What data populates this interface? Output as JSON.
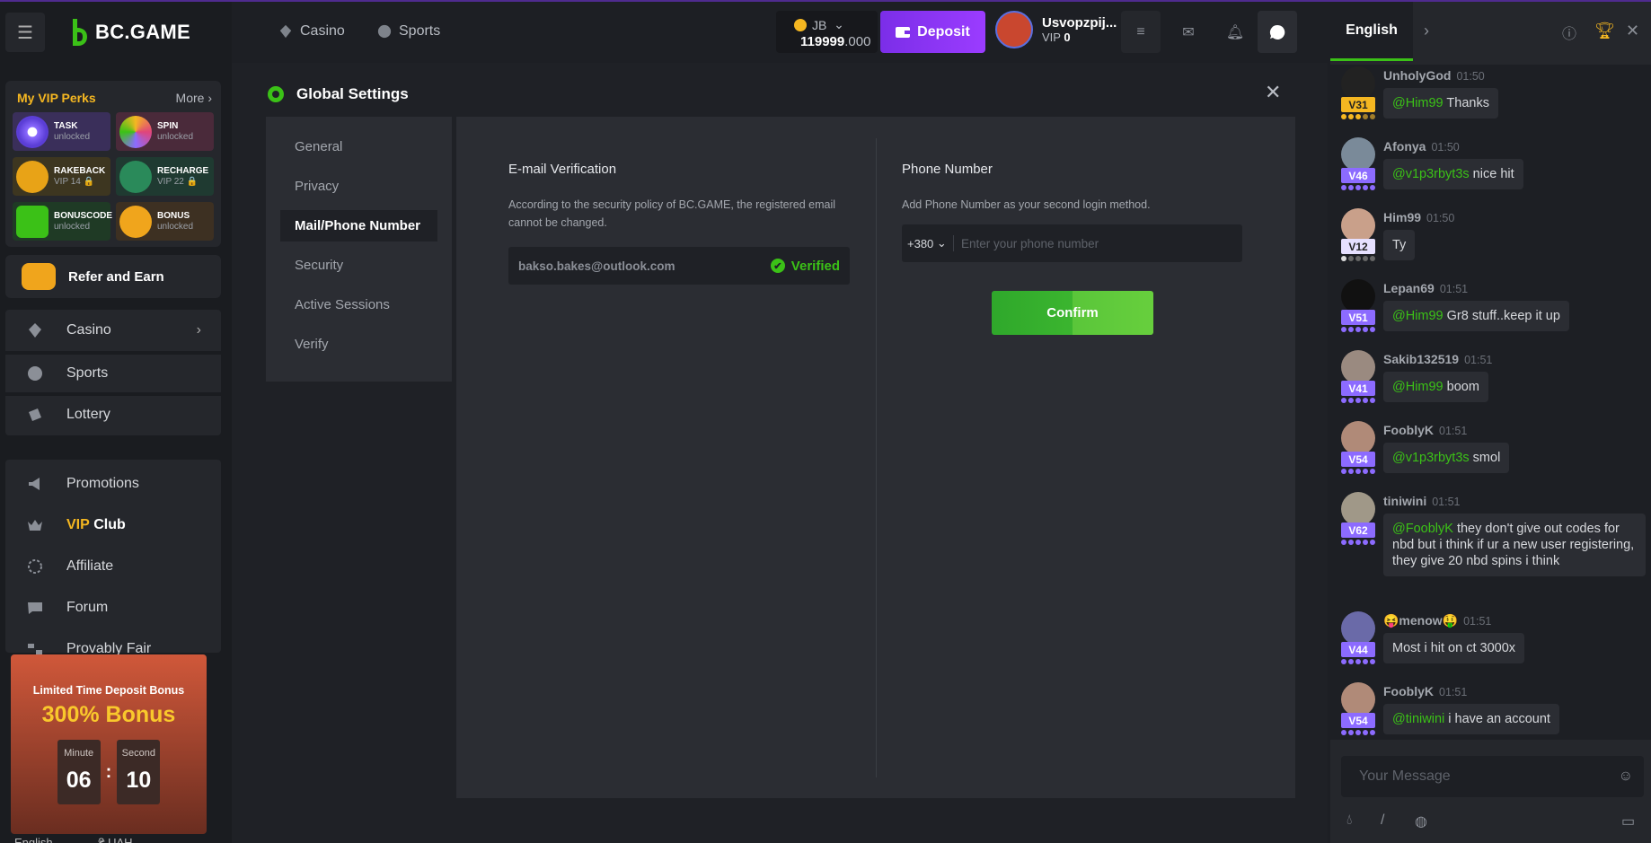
{
  "brand": {
    "name": "BC.GAME",
    "accent": "#3bc117",
    "purple": "#9b3cff",
    "gold": "#f5b721"
  },
  "topbar": {
    "nav": [
      {
        "label": "Casino",
        "icon": "casino-icon"
      },
      {
        "label": "Sports",
        "icon": "sports-icon"
      }
    ],
    "balance": {
      "currency": "JB",
      "amount_main": "119999",
      "amount_decimal": ".000"
    },
    "deposit_label": "Deposit",
    "user": {
      "name": "Usvopzpij...",
      "vip_label": "VIP",
      "vip_value": "0"
    }
  },
  "sidebar": {
    "vip_perks": {
      "title": "My VIP Perks",
      "more": "More",
      "items": [
        {
          "name": "TASK",
          "status": "unlocked",
          "color": "#3a2f5a"
        },
        {
          "name": "SPIN",
          "status": "unlocked",
          "color": "#4a2a3a"
        },
        {
          "name": "RAKEBACK",
          "status": "VIP 14",
          "color": "#3d3620"
        },
        {
          "name": "RECHARGE",
          "status": "VIP 22",
          "color": "#1f3a31"
        },
        {
          "name": "BONUSCODE",
          "status": "unlocked",
          "color": "#1f3a25"
        },
        {
          "name": "BONUS",
          "status": "unlocked",
          "color": "#3d3022"
        }
      ]
    },
    "refer": "Refer and Earn",
    "nav_main": [
      "Casino",
      "Sports",
      "Lottery"
    ],
    "nav_more": {
      "promotions": "Promotions",
      "vip_a": "VIP",
      "vip_b": "Club",
      "affiliate": "Affiliate",
      "forum": "Forum",
      "provably": "Provably Fair"
    },
    "promo": {
      "line1": "Limited Time Deposit Bonus",
      "line2": "300% Bonus",
      "minute_label": "Minute",
      "minute": "06",
      "second_label": "Second",
      "second": "10"
    },
    "footer": {
      "language": "English",
      "currency": "₴ UAH"
    }
  },
  "settings": {
    "title": "Global Settings",
    "menu": [
      "General",
      "Privacy",
      "Mail/Phone Number",
      "Security",
      "Active Sessions",
      "Verify"
    ],
    "active_index": 2,
    "email": {
      "title": "E-mail Verification",
      "desc1": "According to the security policy of BC.GAME, the registered email",
      "desc2": "cannot be changed.",
      "value": "bakso.bakes@outlook.com",
      "status": "Verified"
    },
    "phone": {
      "title": "Phone Number",
      "desc": "Add Phone Number as your second login method.",
      "code": "+380",
      "placeholder": "Enter your phone number",
      "confirm": "Confirm"
    }
  },
  "chat": {
    "tab": "English",
    "placeholder": "Your Message",
    "messages": [
      {
        "user": "UnholyGod",
        "time": "01:50",
        "level": "V31",
        "mention": "@Him99",
        "text": " Thanks"
      },
      {
        "user": "Afonya",
        "time": "01:50",
        "level": "V46",
        "mention": "@v1p3rbyt3s",
        "text": " nice hit"
      },
      {
        "user": "Him99",
        "time": "01:50",
        "level": "V12",
        "mention": "",
        "text": "Ty"
      },
      {
        "user": "Lepan69",
        "time": "01:51",
        "level": "V51",
        "mention": "@Him99",
        "text": " Gr8 stuff..keep it up"
      },
      {
        "user": "Sakib132519",
        "time": "01:51",
        "level": "V41",
        "mention": "@Him99",
        "text": " boom"
      },
      {
        "user": "FooblyK",
        "time": "01:51",
        "level": "V54",
        "mention": "@v1p3rbyt3s",
        "text": " smol"
      },
      {
        "user": "tiniwini",
        "time": "01:51",
        "level": "V62",
        "mention": "@FooblyK",
        "text": " they don't give out codes for nbd but i think if ur a new user registering, they give 20 nbd spins i think"
      },
      {
        "user": "😝menow🤑",
        "time": "01:51",
        "level": "V44",
        "mention": "",
        "text": "Most i hit on ct 3000x"
      },
      {
        "user": "FooblyK",
        "time": "01:51",
        "level": "V54",
        "mention": "@tiniwini",
        "text": " i have an account"
      }
    ]
  }
}
